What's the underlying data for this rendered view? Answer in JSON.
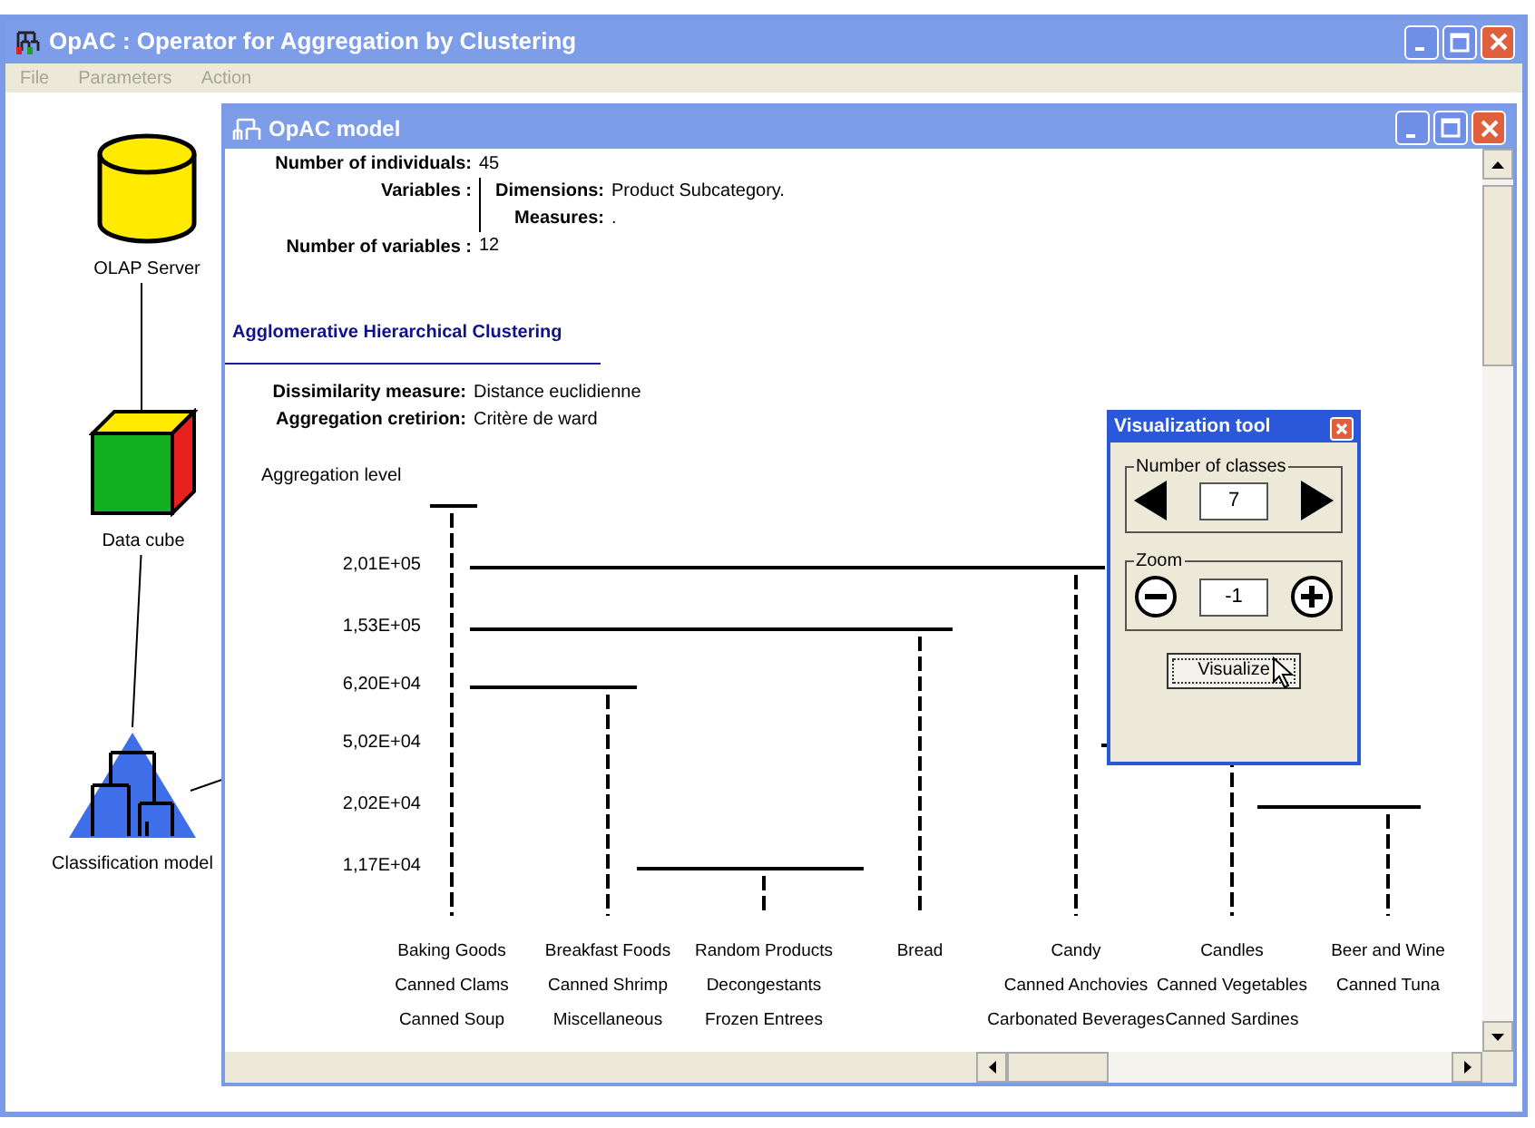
{
  "window": {
    "title": "OpAC : Operator for Aggregation by Clustering"
  },
  "menu": [
    {
      "label": "File",
      "disabled": true
    },
    {
      "label": "Parameters",
      "disabled": true
    },
    {
      "label": "Action",
      "disabled": true
    }
  ],
  "diagram": {
    "nodes": [
      {
        "kind": "database",
        "label": "OLAP Server"
      },
      {
        "kind": "cube",
        "label": "Data cube"
      },
      {
        "kind": "model",
        "label": "Classification model"
      }
    ]
  },
  "model_window": {
    "title": "OpAC model",
    "individuals": {
      "label": "Number of individuals:",
      "value": "45"
    },
    "variables": {
      "label": "Variables :",
      "dimensions_label": "Dimensions:",
      "dimensions_value": "Product Subcategory.",
      "measures_label": "Measures:",
      "measures_value": "."
    },
    "variable_count": {
      "label": "Number of variables :",
      "value": "12"
    },
    "section_title": "Agglomerative Hierarchical Clustering",
    "dissimilarity": {
      "label": "Dissimilarity measure:",
      "value": "Distance euclidienne"
    },
    "criterion": {
      "label": "Aggregation cretirion:",
      "value": "Critère de ward"
    },
    "dendrogram": {
      "axis_title": "Aggregation level",
      "level_labels": [
        "2,01E+05",
        "1,53E+05",
        "6,20E+04",
        "5,02E+04",
        "2,02E+04",
        "1,17E+04"
      ],
      "leaves": [
        {
          "row_1": "Baking Goods",
          "row_2": "Canned Clams",
          "row_3": "Canned Soup"
        },
        {
          "row_1": "Breakfast Foods",
          "row_2": "Canned Shrimp",
          "row_3": "Miscellaneous"
        },
        {
          "row_1": "Random Products",
          "row_2": "Decongestants",
          "row_3": "Frozen Entrees"
        },
        {
          "row_1": "Bread"
        },
        {
          "row_1": "Candy",
          "row_2": "Canned Anchovies",
          "row_3": "Carbonated Beverages"
        },
        {
          "row_1": "Candles",
          "row_2": "Canned Vegetables",
          "row_3": "Canned Sardines"
        },
        {
          "row_1": "Beer and Wine",
          "row_2": "Canned Tuna"
        }
      ]
    }
  },
  "tool_window": {
    "title": "Visualization tool",
    "classes": {
      "legend": "Number of classes",
      "value": "7"
    },
    "zoom": {
      "legend": "Zoom",
      "value": "-1"
    },
    "button": "Visualize"
  }
}
